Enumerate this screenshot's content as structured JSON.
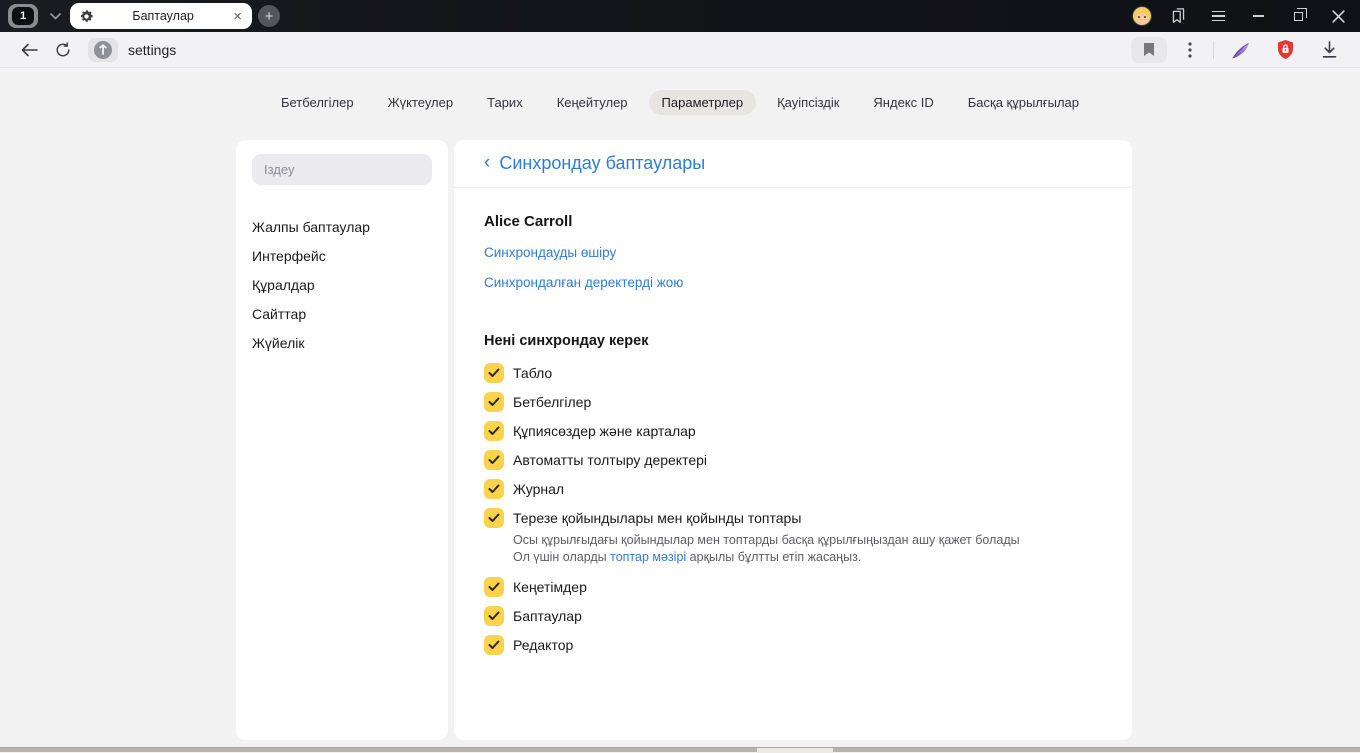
{
  "titlebar": {
    "tab_counter": "1",
    "tab_title": "Баптаулар",
    "new_tab_glyph": "+"
  },
  "toolbar": {
    "url": "settings"
  },
  "nav": {
    "items": [
      {
        "label": "Бетбелгілер"
      },
      {
        "label": "Жүктеулер"
      },
      {
        "label": "Тарих"
      },
      {
        "label": "Кеңейтулер"
      },
      {
        "label": "Параметрлер"
      },
      {
        "label": "Қауіпсіздік"
      },
      {
        "label": "Яндекс ID"
      },
      {
        "label": "Басқа құрылғылар"
      }
    ]
  },
  "sidebar": {
    "search_placeholder": "Іздеу",
    "items": [
      {
        "label": "Жалпы баптаулар"
      },
      {
        "label": "Интерфейс"
      },
      {
        "label": "Құралдар"
      },
      {
        "label": "Сайттар"
      },
      {
        "label": "Жүйелік"
      }
    ]
  },
  "main": {
    "back_glyph": "‹",
    "title": "Синхрондау баптаулары",
    "account_name": "Alice Carroll",
    "links": {
      "disable_sync": "Синхрондауды өшіру",
      "delete_synced_data": "Синхрондалған деректерді жою"
    },
    "section_title": "Нені синхрондау керек",
    "checkboxes": [
      {
        "label": "Табло",
        "checked": true
      },
      {
        "label": "Бетбелгілер",
        "checked": true
      },
      {
        "label": "Құпиясөздер және карталар",
        "checked": true
      },
      {
        "label": "Автоматты толтыру деректері",
        "checked": true
      },
      {
        "label": "Журнал",
        "checked": true
      },
      {
        "label": "Терезе қойындылары мен қойынды топтары",
        "checked": true,
        "desc_line1": "Осы құрылғыдағы қойындылар мен топтарды басқа құрылғыңыздан ашу қажет болады",
        "desc_line2_pre": "Ол үшін оларды ",
        "desc_line2_link": "топтар мәзірі",
        "desc_line2_post": " арқылы бұлтты етіп жасаңыз."
      },
      {
        "label": "Кеңетімдер",
        "checked": true
      },
      {
        "label": "Баптаулар",
        "checked": true
      },
      {
        "label": "Редактор",
        "checked": true
      }
    ]
  },
  "colors": {
    "accent_blue": "#2f7cd6",
    "checkbox_yellow": "#fbd24b",
    "protect_red": "#e23a32",
    "feather_purple": "#8a5bd6"
  }
}
